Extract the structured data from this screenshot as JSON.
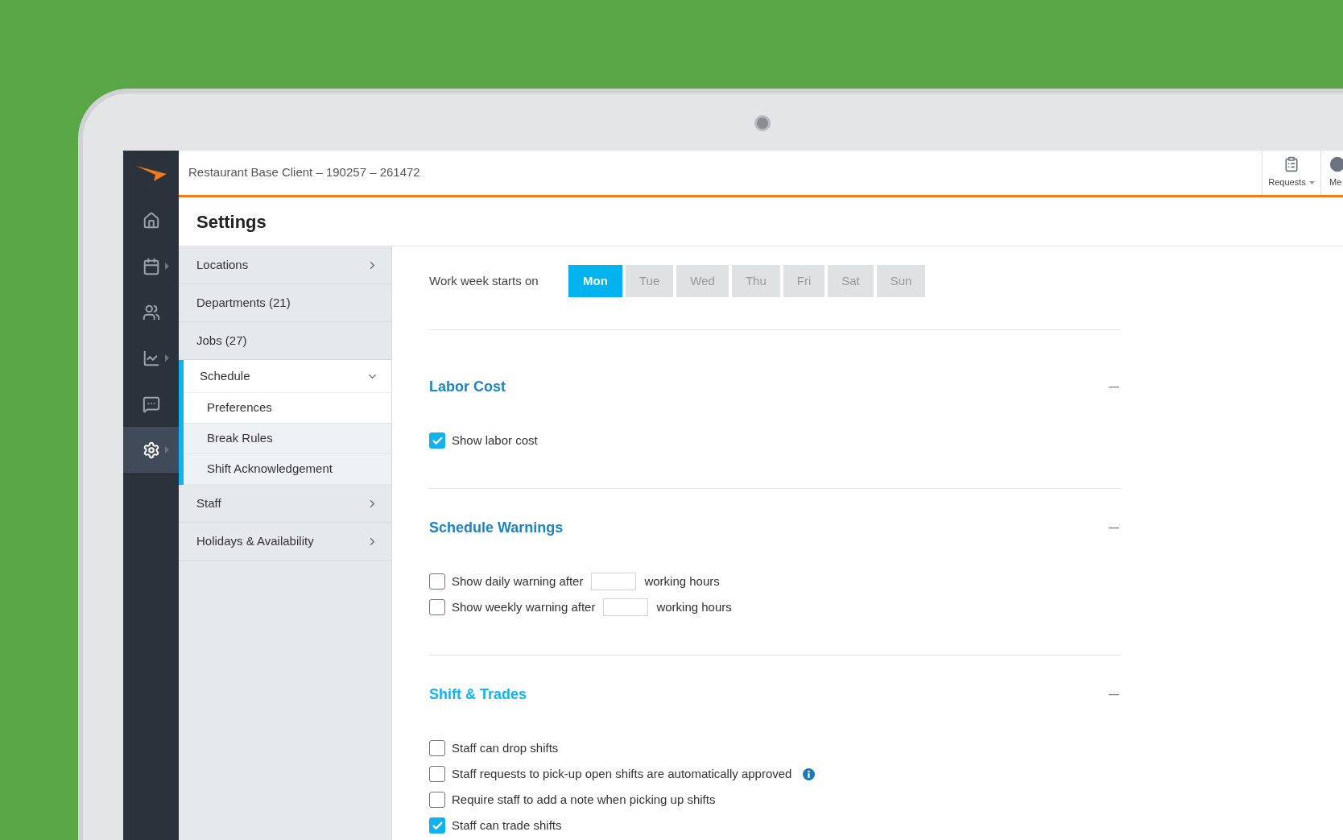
{
  "header": {
    "title": "Restaurant Base Client – 190257 – 261472",
    "nav": [
      {
        "kind": "requests",
        "label": "Requests"
      },
      {
        "kind": "me",
        "label": "Me"
      }
    ]
  },
  "rail": [
    {
      "kind": "home",
      "selected": false,
      "submenu": false
    },
    {
      "kind": "calendar",
      "selected": false,
      "submenu": true
    },
    {
      "kind": "people",
      "selected": false,
      "submenu": false
    },
    {
      "kind": "chart",
      "selected": false,
      "submenu": true
    },
    {
      "kind": "chat",
      "selected": false,
      "submenu": false
    },
    {
      "kind": "settings",
      "selected": true,
      "submenu": true
    }
  ],
  "page_title": "Settings",
  "menu": [
    {
      "label": "Locations",
      "expanded": false
    },
    {
      "label": "Departments (21)"
    },
    {
      "label": "Jobs (27)"
    },
    {
      "label": "Schedule",
      "expanded": true,
      "children": [
        {
          "label": "Preferences",
          "selected": true
        },
        {
          "label": "Break Rules",
          "selected": false
        },
        {
          "label": "Shift Acknowledgement",
          "selected": false
        }
      ]
    },
    {
      "label": "Staff",
      "expanded": false
    },
    {
      "label": "Holidays & Availability",
      "expanded": false
    }
  ],
  "work_week": {
    "label": "Work week starts on",
    "days": [
      {
        "label": "Mon",
        "selected": true
      },
      {
        "label": "Tue",
        "selected": false
      },
      {
        "label": "Wed",
        "selected": false
      },
      {
        "label": "Thu",
        "selected": false
      },
      {
        "label": "Fri",
        "selected": false
      },
      {
        "label": "Sat",
        "selected": false
      },
      {
        "label": "Sun",
        "selected": false
      }
    ]
  },
  "sections": [
    {
      "title": "Labor Cost",
      "color": "#1d84c4",
      "expanded": true,
      "options": [
        {
          "kind": "checkbox",
          "label": "Show labor cost",
          "checked": true
        }
      ]
    },
    {
      "title": "Schedule Warnings",
      "color": "#1d84c4",
      "expanded": true,
      "options": [
        {
          "kind": "hours",
          "label": "Show daily warning after",
          "suffix": "working hours",
          "checked": false
        },
        {
          "kind": "hours",
          "label": "Show weekly warning after",
          "suffix": "working hours",
          "checked": false
        }
      ]
    },
    {
      "title": "Shift & Trades",
      "color": "#16b2ee",
      "expanded": true,
      "options": [
        {
          "kind": "checkbox",
          "label": "Staff can drop shifts",
          "checked": false
        },
        {
          "kind": "checkbox",
          "label": "Staff requests to pick-up open shifts are automatically approved",
          "checked": false,
          "info": true
        },
        {
          "kind": "checkbox",
          "label": "Require staff to add a note when picking up shifts",
          "checked": false
        },
        {
          "kind": "checkbox",
          "label": "Staff can trade shifts",
          "checked": true
        }
      ]
    }
  ]
}
